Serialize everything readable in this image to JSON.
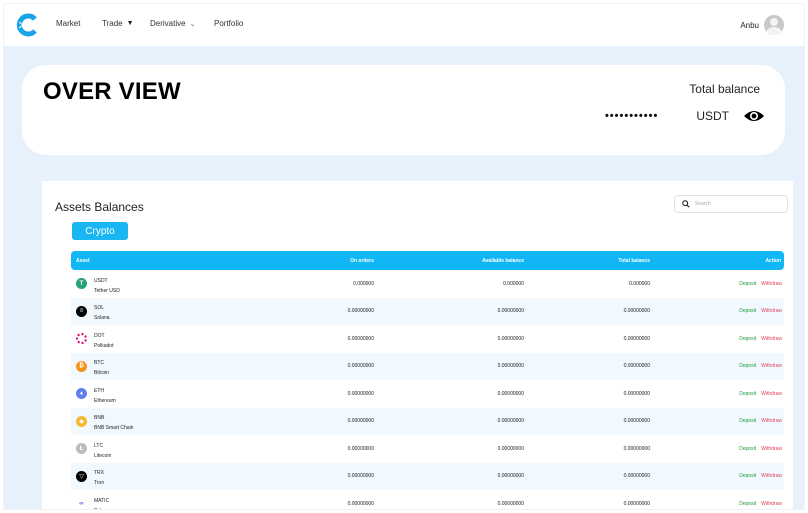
{
  "nav": {
    "logo": "c-logo",
    "items": [
      {
        "label": "Market",
        "has_dropdown": false
      },
      {
        "label": "Trade",
        "has_dropdown": true
      },
      {
        "label": "Derivative",
        "has_dropdown": true
      },
      {
        "label": "Portfolio",
        "has_dropdown": false
      }
    ],
    "user_name": "Anbu"
  },
  "overview": {
    "title": "OVER VIEW",
    "total_balance_label": "Total balance",
    "masked_balance": "•••••••••••",
    "currency": "USDT",
    "visibility_icon": "eye-icon"
  },
  "assets": {
    "title": "Assets Balances",
    "search_placeholder": "Search",
    "tab_label": "Crypto",
    "columns": [
      "Asset",
      "On orders",
      "Available balance",
      "Total balance",
      "Action"
    ],
    "deposit_label": "Deposit",
    "withdraw_label": "Withdraw",
    "rows": [
      {
        "symbol": "USDT",
        "name": "Tether USD",
        "on_orders": "0.000000",
        "available": "0.000000",
        "total": "0.000000",
        "icon_color": "#26a17b",
        "glyph": "T"
      },
      {
        "symbol": "SOL",
        "name": "Solana",
        "on_orders": "0.00000000",
        "available": "0.00000000",
        "total": "0.00000000",
        "icon_color": "#000000",
        "glyph": "≡"
      },
      {
        "symbol": "DOT",
        "name": "Polkadot",
        "on_orders": "0.00000000",
        "available": "0.00000000",
        "total": "0.00000000",
        "icon_color": "#e6007a",
        "glyph": ""
      },
      {
        "symbol": "BTC",
        "name": "Bitcoin",
        "on_orders": "0.00000000",
        "available": "0.00000000",
        "total": "0.00000000",
        "icon_color": "#f7931a",
        "glyph": "₿"
      },
      {
        "symbol": "ETH",
        "name": "Ethereum",
        "on_orders": "0.00000000",
        "available": "0.00000000",
        "total": "0.00000000",
        "icon_color": "#627eea",
        "glyph": "♦"
      },
      {
        "symbol": "BNB",
        "name": "BNB Smart Chain",
        "on_orders": "0.00000000",
        "available": "0.00000000",
        "total": "0.00000000",
        "icon_color": "#f3ba2f",
        "glyph": "◆"
      },
      {
        "symbol": "LTC",
        "name": "Litecoin",
        "on_orders": "0.00000000",
        "available": "0.00000000",
        "total": "0.00000000",
        "icon_color": "#bfbbbb",
        "glyph": "Ł"
      },
      {
        "symbol": "TRX",
        "name": "Tron",
        "on_orders": "0.00000000",
        "available": "0.00000000",
        "total": "0.00000000",
        "icon_color": "#000000",
        "glyph": "▽"
      },
      {
        "symbol": "MATIC",
        "name": "Polygon",
        "on_orders": "0.00000000",
        "available": "0.00000000",
        "total": "0.00000000",
        "icon_color": "#8247e5",
        "glyph": "∞"
      }
    ]
  },
  "colors": {
    "accent": "#11b7f4",
    "page_bg": "#e6f1fb",
    "deposit": "#1e9c3a",
    "withdraw": "#e0405a"
  }
}
